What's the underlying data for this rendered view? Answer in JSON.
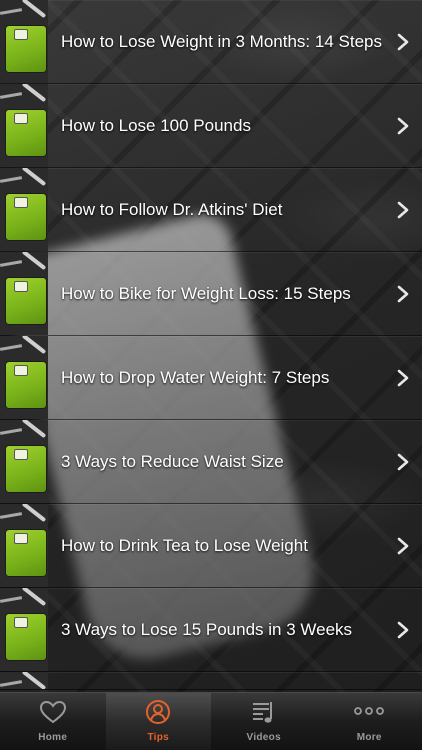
{
  "list": {
    "items": [
      {
        "title": "How to Lose Weight in 3 Months: 14 Steps",
        "icon": "scale-thumbnail",
        "chevron": "chevron-right-icon"
      },
      {
        "title": "How to Lose 100 Pounds",
        "icon": "scale-thumbnail",
        "chevron": "chevron-right-icon"
      },
      {
        "title": "How to Follow Dr. Atkins' Diet",
        "icon": "scale-thumbnail",
        "chevron": "chevron-right-icon"
      },
      {
        "title": "How to Bike for Weight Loss: 15 Steps",
        "icon": "scale-thumbnail",
        "chevron": "chevron-right-icon"
      },
      {
        "title": "How to Drop Water Weight: 7 Steps",
        "icon": "scale-thumbnail",
        "chevron": "chevron-right-icon"
      },
      {
        "title": "3 Ways to Reduce Waist Size",
        "icon": "scale-thumbnail",
        "chevron": "chevron-right-icon"
      },
      {
        "title": "How to Drink Tea to Lose Weight",
        "icon": "scale-thumbnail",
        "chevron": "chevron-right-icon"
      },
      {
        "title": "3 Ways to Lose 15 Pounds in 3 Weeks",
        "icon": "scale-thumbnail",
        "chevron": "chevron-right-icon"
      }
    ]
  },
  "tabbar": {
    "tabs": [
      {
        "label": "Home",
        "icon": "heart-icon",
        "active": false
      },
      {
        "label": "Tips",
        "icon": "tips-badge-icon",
        "active": true
      },
      {
        "label": "Videos",
        "icon": "playlist-icon",
        "active": false
      },
      {
        "label": "More",
        "icon": "more-dots-icon",
        "active": false
      }
    ]
  },
  "colors": {
    "accent": "#e4622b",
    "thumbnail_green": "#8cc422",
    "text": "#ffffff",
    "tab_inactive": "#9a9a9a"
  }
}
